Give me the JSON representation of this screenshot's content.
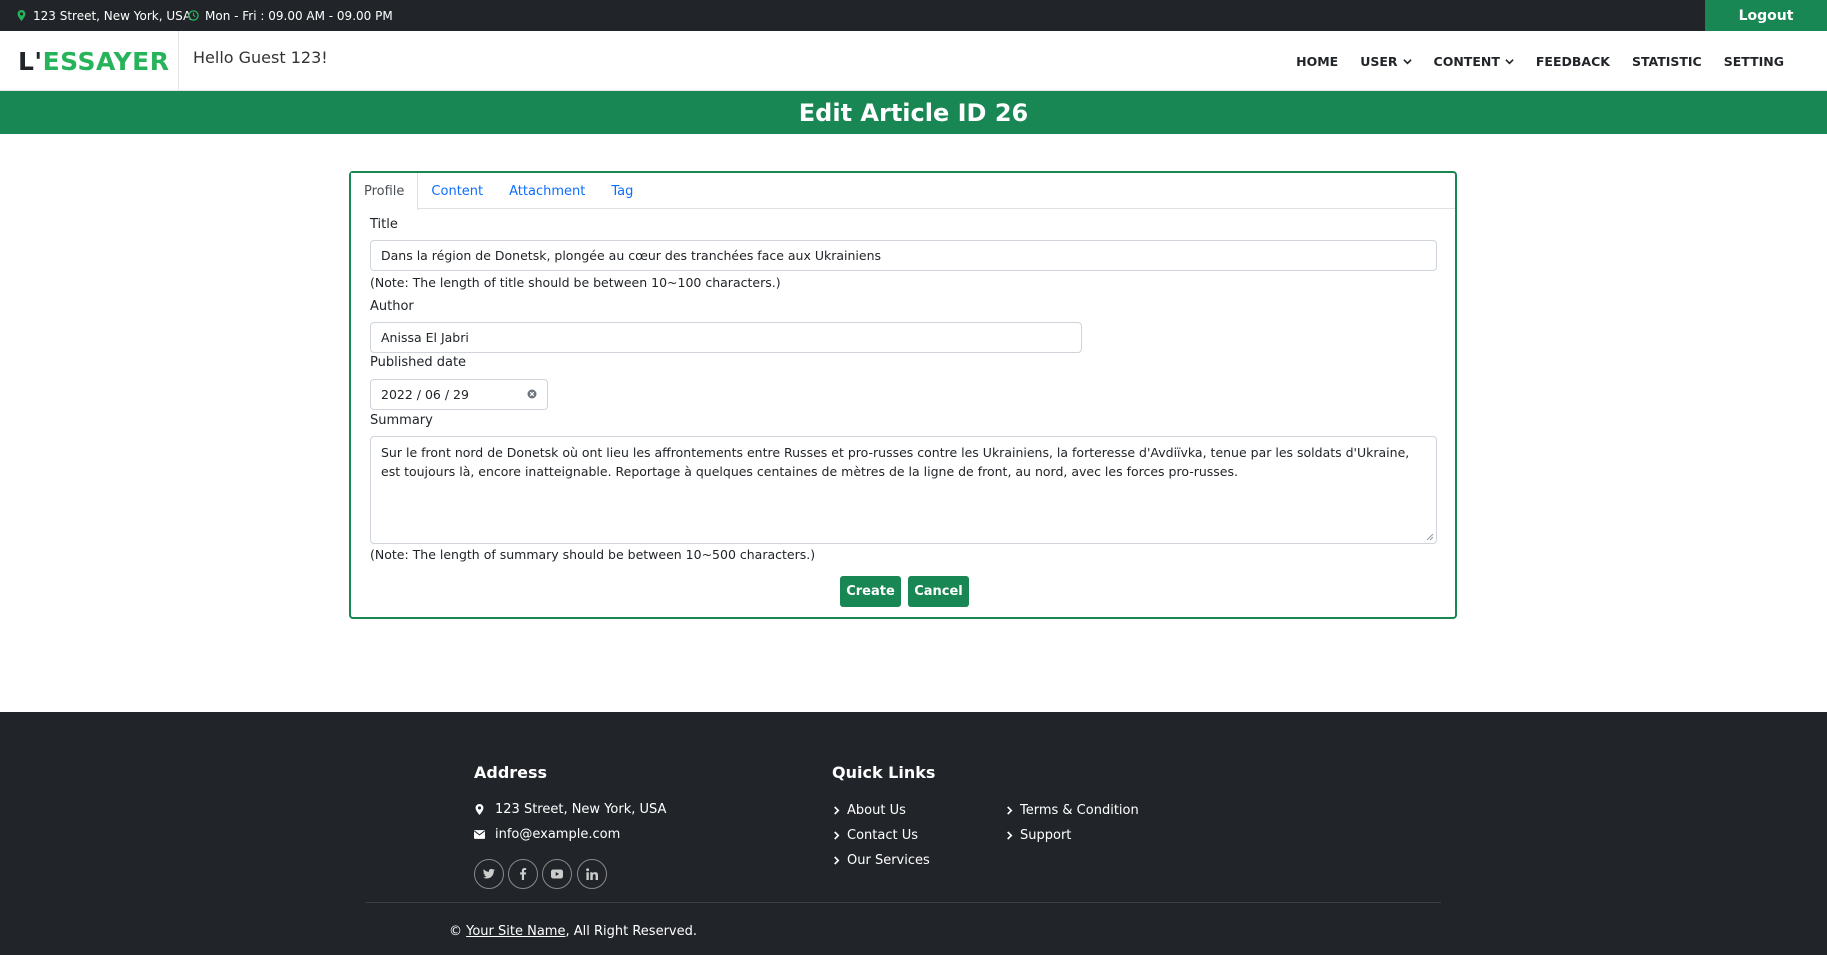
{
  "topbar": {
    "address": "123 Street, New York, USA",
    "hours": "Mon - Fri : 09.00 AM - 09.00 PM",
    "logout": "Logout"
  },
  "brand": {
    "part1": "L'",
    "part2": "ESSAYER"
  },
  "greeting": "Hello Guest 123!",
  "nav": {
    "home": "HOME",
    "user": "USER",
    "content": "CONTENT",
    "feedback": "FEEDBACK",
    "statistic": "STATISTIC",
    "setting": "SETTING"
  },
  "banner": {
    "title": "Edit Article ID 26"
  },
  "tabs": [
    "Profile",
    "Content",
    "Attachment",
    "Tag"
  ],
  "form": {
    "title_label": "Title",
    "title_value": "Dans la région de Donetsk, plongée au cœur des tranchées face aux Ukrainiens",
    "title_note": "(Note: The length of title should be between 10~100 characters.)",
    "author_label": "Author",
    "author_value": "Anissa El Jabri",
    "date_label": "Published date",
    "date_value": "2022 / 06 / 29",
    "summary_label": "Summary",
    "summary_value": "Sur le front nord de Donetsk où ont lieu les affrontements entre Russes et pro-russes contre les Ukrainiens, la forteresse d'Avdiïvka, tenue par les soldats d'Ukraine, est toujours là, encore inatteignable. Reportage à quelques centaines de mètres de la ligne de front, au nord, avec les forces pro-russes.",
    "summary_note": "(Note: The length of summary should be between 10~500 characters.)",
    "create": "Create",
    "cancel": "Cancel"
  },
  "footer": {
    "address_heading": "Address",
    "address": "123 Street, New York, USA",
    "email": "info@example.com",
    "quick_heading": "Quick Links",
    "links": [
      "About Us",
      "Contact Us",
      "Our Services",
      "Terms & Condition",
      "Support"
    ],
    "copyright_prefix": "©",
    "site_name": "Your Site Name",
    "copyright_suffix": ", All Right Reserved."
  },
  "colors": {
    "primary": "#198754",
    "dark": "#212529",
    "brand_green": "#27b35a"
  }
}
